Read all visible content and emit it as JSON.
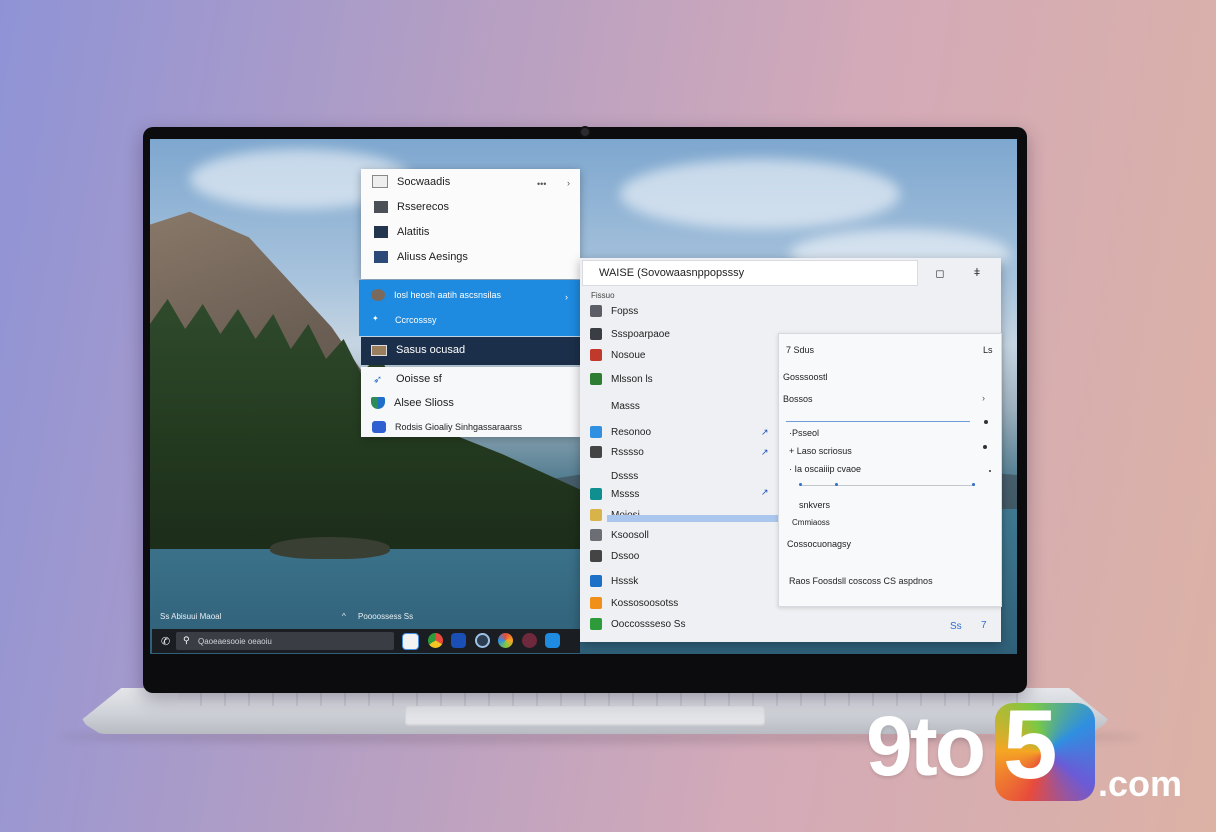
{
  "left_menu": {
    "top_items": [
      {
        "label": "Socwaadis",
        "icon": "window-icon"
      },
      {
        "label": "Rsserecos",
        "icon": "image-icon"
      },
      {
        "label": "Alatitis",
        "icon": "document-icon"
      },
      {
        "label": "Aliuss Aesings",
        "icon": "photo-icon"
      }
    ],
    "highlight_items": [
      {
        "label": "Iosl heosh aatih ascsnsilas",
        "icon": "avatar-icon"
      },
      {
        "label": "Ccrcosssy",
        "icon": "sparkle-icon"
      }
    ],
    "dark_item": {
      "label": "Sasus ocusad",
      "icon": "folder-icon"
    },
    "bottom_items": [
      {
        "label": "Ooisse sf",
        "icon": "feather-icon"
      },
      {
        "label": "Alsee Slioss",
        "icon": "shield-icon"
      },
      {
        "label": "Rodsis Gioaliy Sinhgassaraarss",
        "icon": "edge-icon"
      }
    ]
  },
  "settings_window": {
    "title": "WAISE (Sovowaasnppopsssy",
    "section_label": "Fissuo",
    "nav_items": [
      {
        "label": "Fopss",
        "icon": "folder-icon",
        "color": "#5b5e66"
      },
      {
        "label": "Ssspoarpaoe",
        "icon": "monitor-icon",
        "color": "#3a3d44"
      },
      {
        "label": "Nosoue",
        "icon": "network-icon",
        "color": "#c0392b"
      },
      {
        "label": "Mlsson ls",
        "icon": "apps-icon",
        "color": "#2e7d32"
      },
      {
        "label": "Masss",
        "icon": "none",
        "color": ""
      },
      {
        "label": "Resonoo",
        "icon": "display-icon",
        "color": "#2f8fe0"
      },
      {
        "label": "Rsssso",
        "icon": "clock-icon",
        "color": "#444444"
      },
      {
        "label": "Dssss",
        "icon": "none",
        "color": ""
      },
      {
        "label": "Mssss",
        "icon": "globe-icon",
        "color": "#0f8f8f"
      },
      {
        "label": "Moiosi",
        "icon": "circle-icon",
        "color": "#d8b34a"
      },
      {
        "label": "Ksoosoll",
        "icon": "gear-icon",
        "color": "#6b6e75"
      },
      {
        "label": "Dssoo",
        "icon": "doc-icon",
        "color": "#444444"
      },
      {
        "label": "Hsssk",
        "icon": "shield-icon",
        "color": "#1e6fc7"
      },
      {
        "label": "Kossosoosotss",
        "icon": "bar-icon",
        "color": "#f0901a"
      },
      {
        "label": "Ooccossseso Ss",
        "icon": "refresh-icon",
        "color": "#2e9b3a"
      }
    ],
    "detail": {
      "header": "7 Sdus",
      "header_right": "Ls",
      "rows": [
        "Gosssoostl",
        "Bossos",
        "·Psseol",
        "+ Laso scriosus",
        "· Ia oscaiiip cvaoe",
        "snkvers",
        "Cmmiaoss",
        "Cossocuonagsy",
        "Raos Foosdsll coscoss CS aspdnos"
      ]
    },
    "footer_right_a": "Ss",
    "footer_right_b": "7"
  },
  "taskbar": {
    "weather_text": "Ss   Abisuui Maoal",
    "tray_text": "Poooossess Ss",
    "search_placeholder": "Qaoeaesooie oeaoiu",
    "icons": [
      "files-icon",
      "chrome-icon",
      "store-icon",
      "app-icon",
      "color-icon",
      "edge-icon",
      "mail-icon"
    ]
  },
  "watermark": {
    "part1": "9to",
    "part2": "5",
    "part3": ".com"
  },
  "colors": {
    "accent_blue": "#1e8ae0",
    "dark_navy": "#1c2f4a",
    "selection": "#aac6ec"
  }
}
